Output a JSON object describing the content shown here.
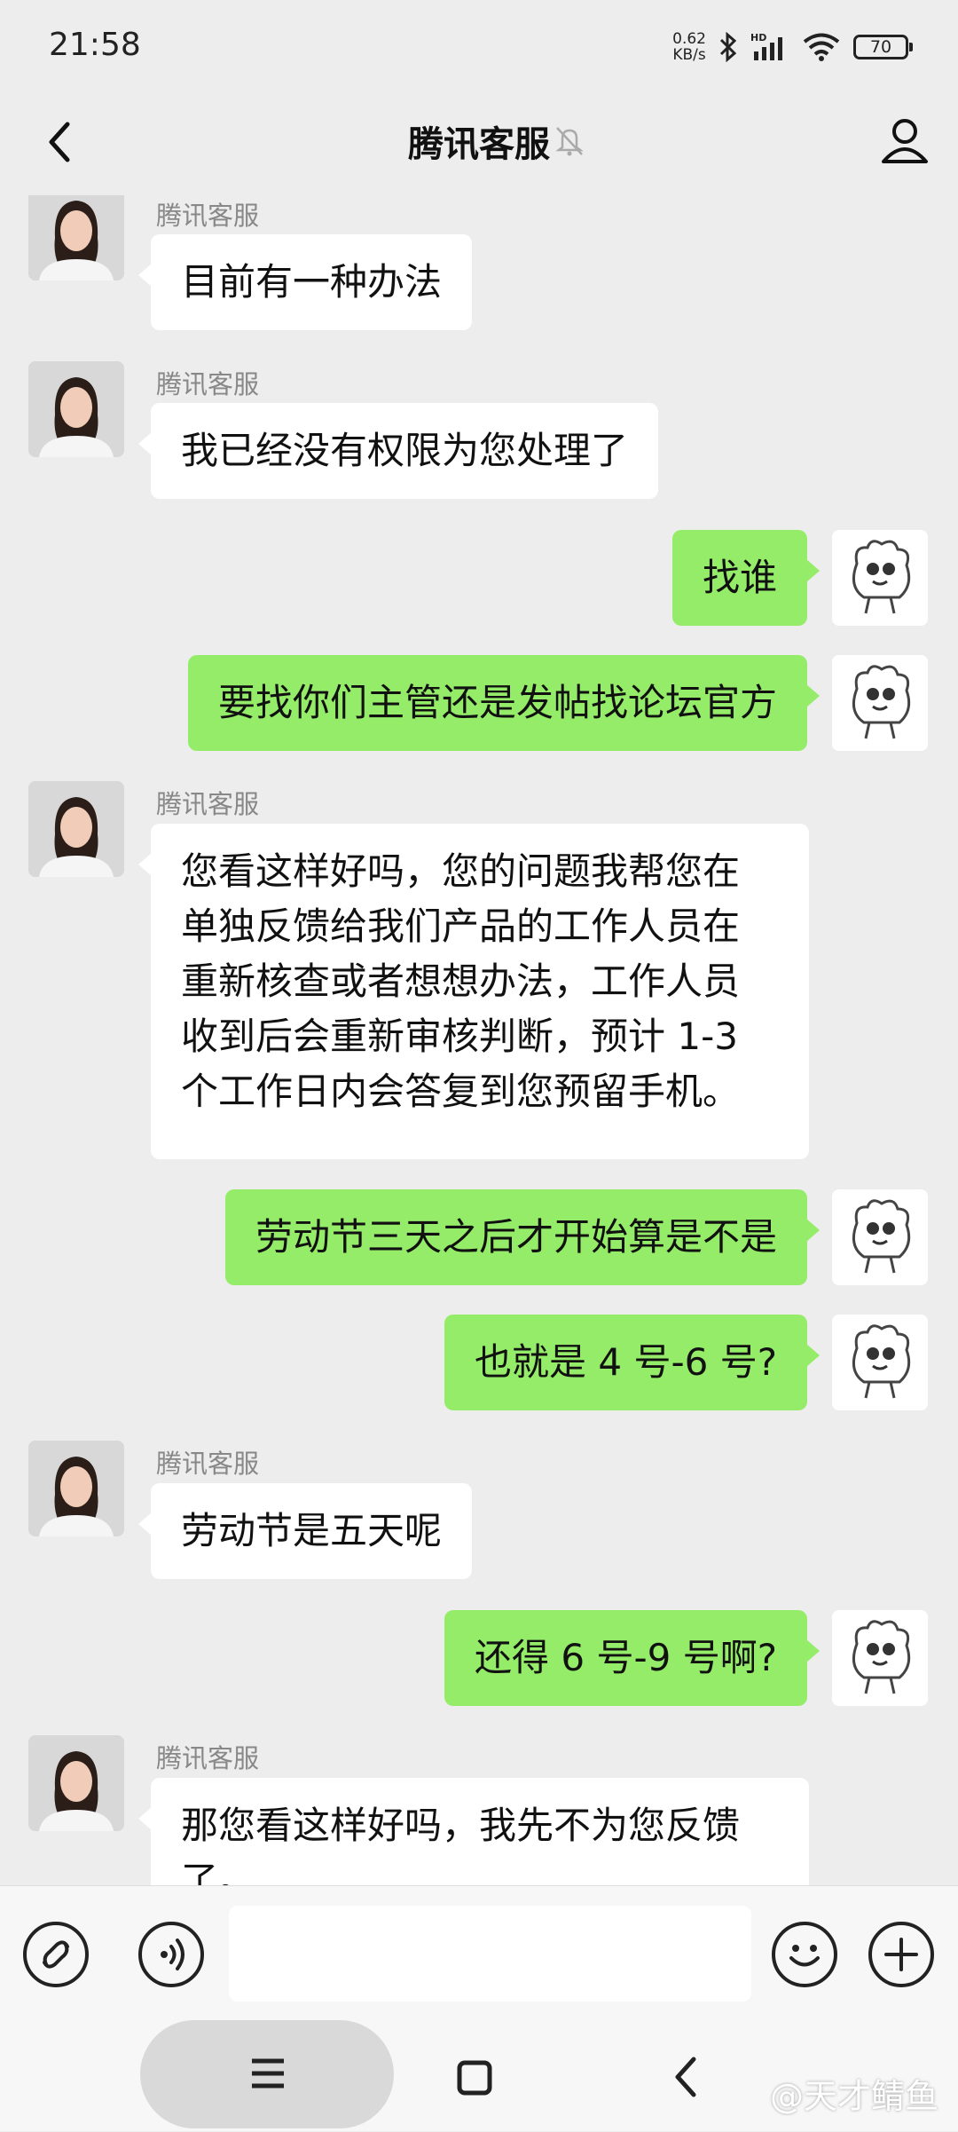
{
  "status": {
    "time": "21:58",
    "net_speed": "0.62",
    "net_unit": "KB/s",
    "battery": "70"
  },
  "nav": {
    "title": "腾讯客服"
  },
  "agent_name": "腾讯客服",
  "messages": [
    {
      "from": "agent",
      "text": [
        "目前有一种办法"
      ]
    },
    {
      "from": "agent",
      "text": [
        "我已经没有权限为您处理了"
      ]
    },
    {
      "from": "me",
      "text": [
        "找谁"
      ]
    },
    {
      "from": "me",
      "text": [
        "要找你们主管还是发帖找论坛官方"
      ]
    },
    {
      "from": "agent",
      "text": [
        "您看这样好吗，您的问题我帮您在",
        "单独反馈给我们产品的工作人员在",
        "重新核查或者想想办法，工作人员",
        "收到后会重新审核判断，预计 1-3",
        "个工作日内会答复到您预留手机。"
      ]
    },
    {
      "from": "me",
      "text": [
        "劳动节三天之后才开始算是不是"
      ]
    },
    {
      "from": "me",
      "text": [
        "也就是 4 号-6 号?"
      ]
    },
    {
      "from": "agent",
      "text": [
        "劳动节是五天呢"
      ]
    },
    {
      "from": "me",
      "text": [
        "还得 6 号-9 号啊?"
      ]
    },
    {
      "from": "agent",
      "text": [
        "那您看这样好吗，我先不为您反馈",
        "了。"
      ]
    }
  ],
  "input": {
    "value": ""
  },
  "watermark": "@天才鲭鱼"
}
